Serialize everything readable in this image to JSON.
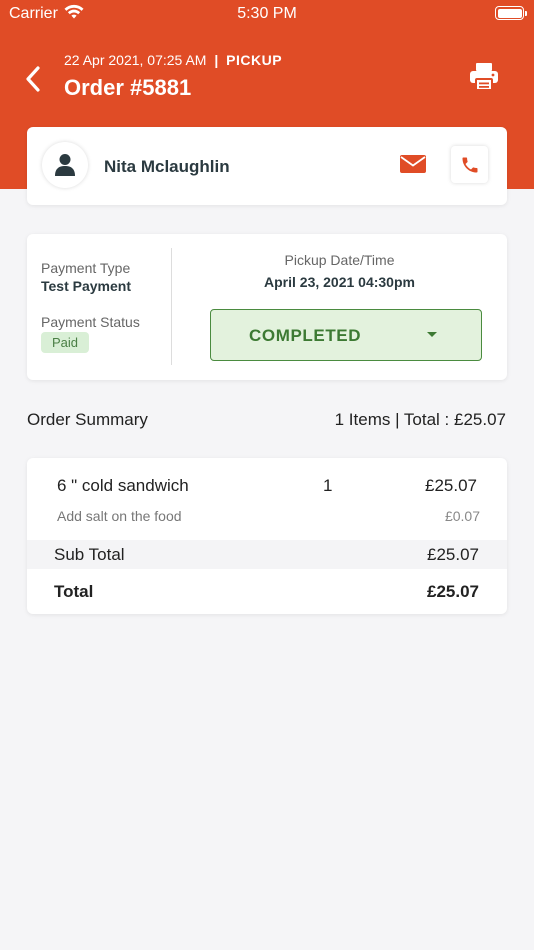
{
  "colors": {
    "brand": "#e04c26",
    "status_green": "#3d7a33",
    "status_bg": "#e3f2dd"
  },
  "status_bar": {
    "carrier": "Carrier",
    "time": "5:30 PM"
  },
  "header": {
    "datetime": "22 Apr 2021, 07:25 AM",
    "separator": "|",
    "order_type": "PICKUP",
    "title": "Order #5881",
    "icons": {
      "back": "chevron-left-icon",
      "print": "printer-icon"
    }
  },
  "customer": {
    "name": "Nita Mclaughlin",
    "icons": {
      "avatar": "user-icon",
      "email": "envelope-icon",
      "call": "phone-icon"
    }
  },
  "payment": {
    "type_label": "Payment Type",
    "type_value": "Test Payment",
    "status_label": "Payment Status",
    "status_value": "Paid",
    "pickup_label": "Pickup Date/Time",
    "pickup_value": "April 23, 2021 04:30pm",
    "order_status": "COMPLETED"
  },
  "summary": {
    "title": "Order Summary",
    "totals_line": "1 Items | Total : £25.07"
  },
  "items": [
    {
      "name": "6 \" cold sandwich",
      "qty": "1",
      "price": "£25.07",
      "modifier_name": "Add salt on the food",
      "modifier_price": "£0.07"
    }
  ],
  "totals": {
    "subtotal_label": "Sub Total",
    "subtotal_value": "£25.07",
    "total_label": "Total",
    "total_value": "£25.07"
  }
}
